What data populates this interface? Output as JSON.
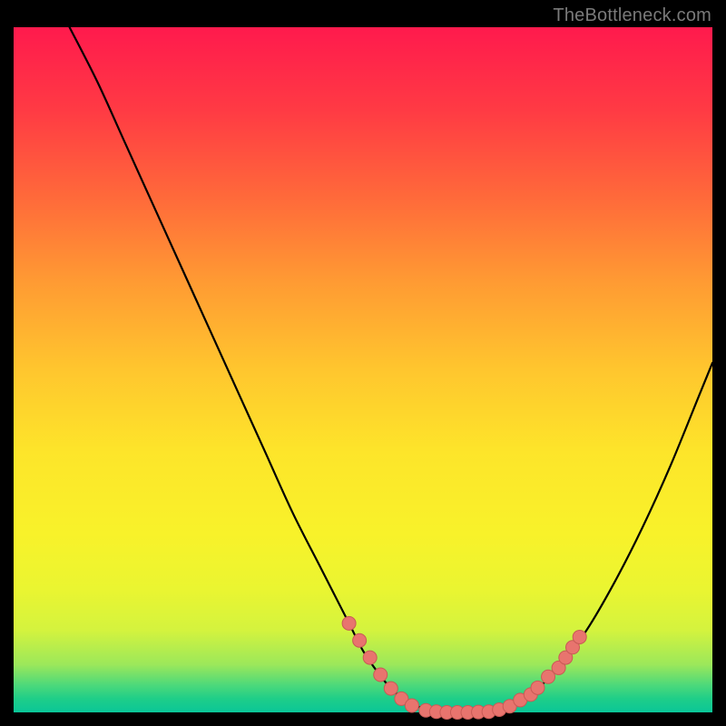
{
  "watermark": "TheBottleneck.com",
  "colors": {
    "curve": "#000000",
    "marker_fill": "#e8746e",
    "marker_stroke": "#c85a55"
  },
  "chart_data": {
    "type": "line",
    "title": "",
    "xlabel": "",
    "ylabel": "",
    "xlim": [
      0,
      100
    ],
    "ylim": [
      0,
      100
    ],
    "note": "V-shaped bottleneck curve; y ≈ 0 is optimal (green), y → 100 is worst (red). Values estimated from pixel positions.",
    "x": [
      8,
      12,
      16,
      20,
      24,
      28,
      32,
      36,
      40,
      44,
      48,
      50,
      52,
      54,
      56,
      58,
      60,
      62,
      64,
      66,
      68,
      70,
      72,
      74,
      78,
      82,
      86,
      90,
      94,
      98,
      100
    ],
    "y": [
      100,
      92,
      83,
      74,
      65,
      56,
      47,
      38,
      29,
      21,
      13,
      9,
      6,
      3.5,
      1.8,
      0.8,
      0.2,
      0,
      0,
      0,
      0.1,
      0.6,
      1.4,
      2.6,
      6.5,
      12,
      19,
      27,
      36,
      46,
      51
    ],
    "markers": {
      "comment": "Salmon circular markers clustered around the flat minimum and lower arms.",
      "points": [
        {
          "x": 48,
          "y": 13
        },
        {
          "x": 49.5,
          "y": 10.5
        },
        {
          "x": 51,
          "y": 8
        },
        {
          "x": 52.5,
          "y": 5.5
        },
        {
          "x": 54,
          "y": 3.5
        },
        {
          "x": 55.5,
          "y": 2.0
        },
        {
          "x": 57,
          "y": 1.0
        },
        {
          "x": 59,
          "y": 0.3
        },
        {
          "x": 60.5,
          "y": 0.1
        },
        {
          "x": 62,
          "y": 0.0
        },
        {
          "x": 63.5,
          "y": 0.0
        },
        {
          "x": 65,
          "y": 0.0
        },
        {
          "x": 66.5,
          "y": 0.05
        },
        {
          "x": 68,
          "y": 0.1
        },
        {
          "x": 69.5,
          "y": 0.4
        },
        {
          "x": 71,
          "y": 0.9
        },
        {
          "x": 72.5,
          "y": 1.8
        },
        {
          "x": 74,
          "y": 2.6
        },
        {
          "x": 75,
          "y": 3.6
        },
        {
          "x": 76.5,
          "y": 5.2
        },
        {
          "x": 78,
          "y": 6.5
        },
        {
          "x": 79,
          "y": 8.0
        },
        {
          "x": 80,
          "y": 9.5
        },
        {
          "x": 81,
          "y": 11.0
        }
      ]
    }
  }
}
